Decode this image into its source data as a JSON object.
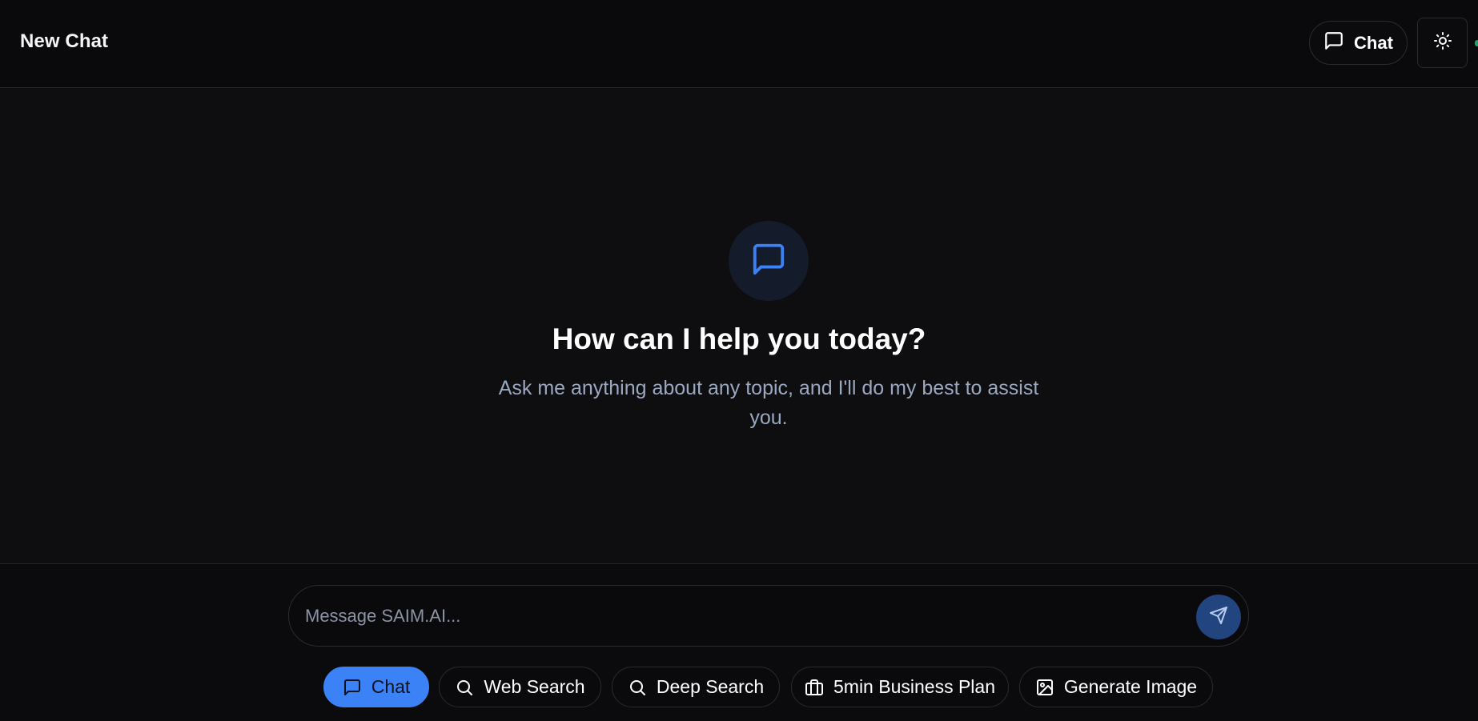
{
  "header": {
    "title": "New Chat",
    "mode_button_label": "Chat",
    "mode_button_icon": "message-square-icon",
    "theme_toggle_icon": "sun-icon"
  },
  "hero": {
    "icon": "message-square-icon",
    "title": "How can I help you today?",
    "subtitle": "Ask me anything about any topic, and I'll do my best to assist you."
  },
  "composer": {
    "placeholder": "Message SAIM.AI...",
    "value": "",
    "send_icon": "send-icon"
  },
  "modes": [
    {
      "label": "Chat",
      "icon": "message-square-icon",
      "active": true
    },
    {
      "label": "Web Search",
      "icon": "search-icon",
      "active": false
    },
    {
      "label": "Deep Search",
      "icon": "search-icon",
      "active": false
    },
    {
      "label": "5min Business Plan",
      "icon": "briefcase-icon",
      "active": false
    },
    {
      "label": "Generate Image",
      "icon": "image-icon",
      "active": false
    }
  ],
  "colors": {
    "accent": "#3b82f6",
    "background": "#0e0e11",
    "header_background": "#0a0a0c",
    "muted_text": "#9aa8c0",
    "send_button": "#23457f"
  }
}
